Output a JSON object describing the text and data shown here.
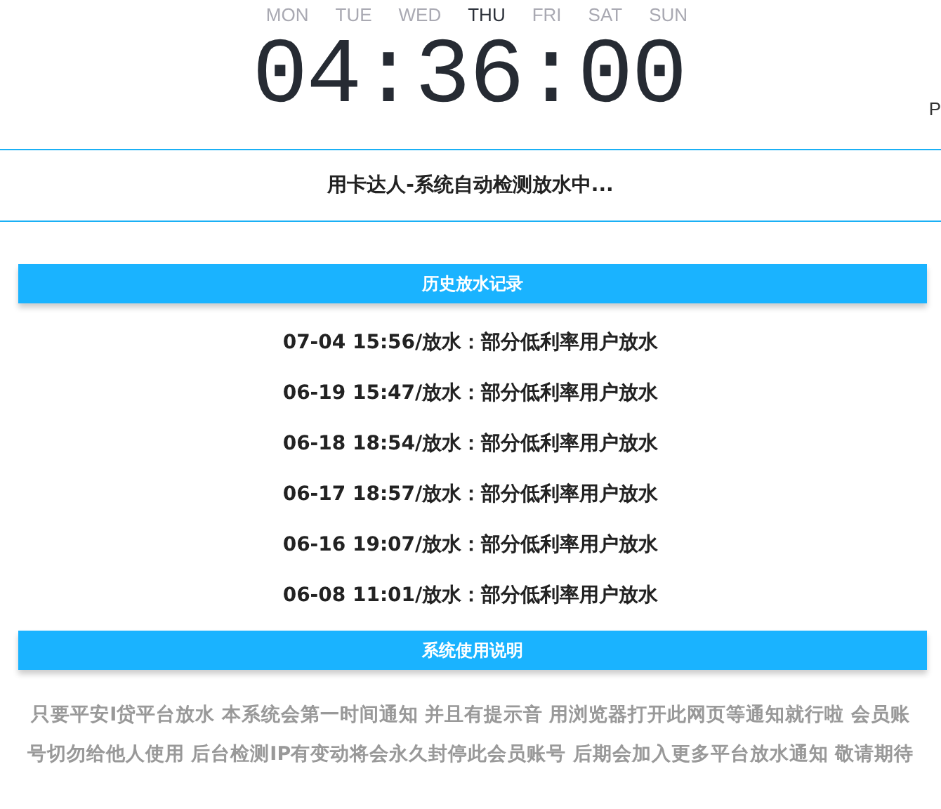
{
  "weekdays": [
    {
      "label": "MON",
      "selected": false
    },
    {
      "label": "TUE",
      "selected": false
    },
    {
      "label": "WED",
      "selected": false
    },
    {
      "label": "THU",
      "selected": true
    },
    {
      "label": "FRI",
      "selected": false
    },
    {
      "label": "SAT",
      "selected": false
    },
    {
      "label": "SUN",
      "selected": false
    }
  ],
  "clock": {
    "time": "04:36:00",
    "meridiem": "P"
  },
  "status": "用卡达人-系统自动检测放水中...",
  "history": {
    "title": "历史放水记录",
    "records": [
      {
        "time": "07-04 15:56",
        "text": "/放水：部分低利率用户放水"
      },
      {
        "time": "06-19 15:47",
        "text": "/放水：部分低利率用户放水"
      },
      {
        "time": "06-18 18:54",
        "text": "/放水：部分低利率用户放水"
      },
      {
        "time": "06-17 18:57",
        "text": "/放水：部分低利率用户放水"
      },
      {
        "time": "06-16 19:07",
        "text": "/放水：部分低利率用户放水"
      },
      {
        "time": "06-08 11:01",
        "text": "/放水：部分低利率用户放水"
      }
    ]
  },
  "instructions": {
    "title": "系统使用说明",
    "text": "只要平安I贷平台放水 本系统会第一时间通知 并且有提示音 用浏览器打开此网页等通知就行啦 会员账号切勿给他人使用 后台检测IP有变动将会永久封停此会员账号 后期会加入更多平台放水通知 敬请期待"
  }
}
